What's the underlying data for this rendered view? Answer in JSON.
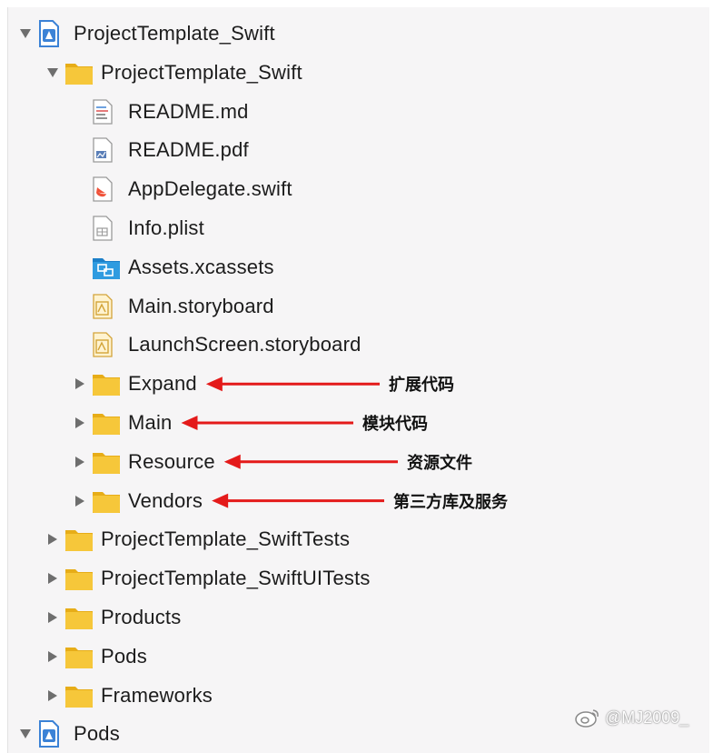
{
  "navigator": {
    "items": [
      {
        "label": "ProjectTemplate_Swift",
        "icon": "project-file-icon",
        "depth": 0,
        "disclosure": "expanded"
      },
      {
        "label": "ProjectTemplate_Swift",
        "icon": "folder-icon",
        "depth": 1,
        "disclosure": "expanded"
      },
      {
        "label": "README.md",
        "icon": "markdown-file-icon",
        "depth": 2,
        "disclosure": "none"
      },
      {
        "label": "README.pdf",
        "icon": "pdf-file-icon",
        "depth": 2,
        "disclosure": "none"
      },
      {
        "label": "AppDelegate.swift",
        "icon": "swift-file-icon",
        "depth": 2,
        "disclosure": "none"
      },
      {
        "label": "Info.plist",
        "icon": "plist-file-icon",
        "depth": 2,
        "disclosure": "none"
      },
      {
        "label": "Assets.xcassets",
        "icon": "asset-catalog-icon",
        "depth": 2,
        "disclosure": "none"
      },
      {
        "label": "Main.storyboard",
        "icon": "storyboard-file-icon",
        "depth": 2,
        "disclosure": "none"
      },
      {
        "label": "LaunchScreen.storyboard",
        "icon": "storyboard-file-icon",
        "depth": 2,
        "disclosure": "none"
      },
      {
        "label": "Expand",
        "icon": "folder-icon",
        "depth": 2,
        "disclosure": "collapsed"
      },
      {
        "label": "Main",
        "icon": "folder-icon",
        "depth": 2,
        "disclosure": "collapsed"
      },
      {
        "label": "Resource",
        "icon": "folder-icon",
        "depth": 2,
        "disclosure": "collapsed"
      },
      {
        "label": "Vendors",
        "icon": "folder-icon",
        "depth": 2,
        "disclosure": "collapsed"
      },
      {
        "label": "ProjectTemplate_SwiftTests",
        "icon": "folder-icon",
        "depth": 1,
        "disclosure": "collapsed"
      },
      {
        "label": "ProjectTemplate_SwiftUITests",
        "icon": "folder-icon",
        "depth": 1,
        "disclosure": "collapsed"
      },
      {
        "label": "Products",
        "icon": "folder-icon",
        "depth": 1,
        "disclosure": "collapsed"
      },
      {
        "label": "Pods",
        "icon": "folder-icon",
        "depth": 1,
        "disclosure": "collapsed"
      },
      {
        "label": "Frameworks",
        "icon": "folder-icon",
        "depth": 1,
        "disclosure": "collapsed"
      },
      {
        "label": "Pods",
        "icon": "project-file-icon",
        "depth": 0,
        "disclosure": "expanded"
      }
    ]
  },
  "annotations": [
    {
      "target": "Expand",
      "text": "扩展代码"
    },
    {
      "target": "Main",
      "text": "模块代码"
    },
    {
      "target": "Resource",
      "text": "资源文件"
    },
    {
      "target": "Vendors",
      "text": "第三方库及服务"
    }
  ],
  "watermark": {
    "text": "@MJ2009_",
    "icon": "weibo-logo-icon"
  },
  "colors": {
    "folder": "#f6c73a",
    "folder_dark": "#e7ad18",
    "arrow": "#e41a1a",
    "project_blue": "#3b82d6",
    "asset_blue": "#2f9be0",
    "swift_orange": "#f05138"
  }
}
